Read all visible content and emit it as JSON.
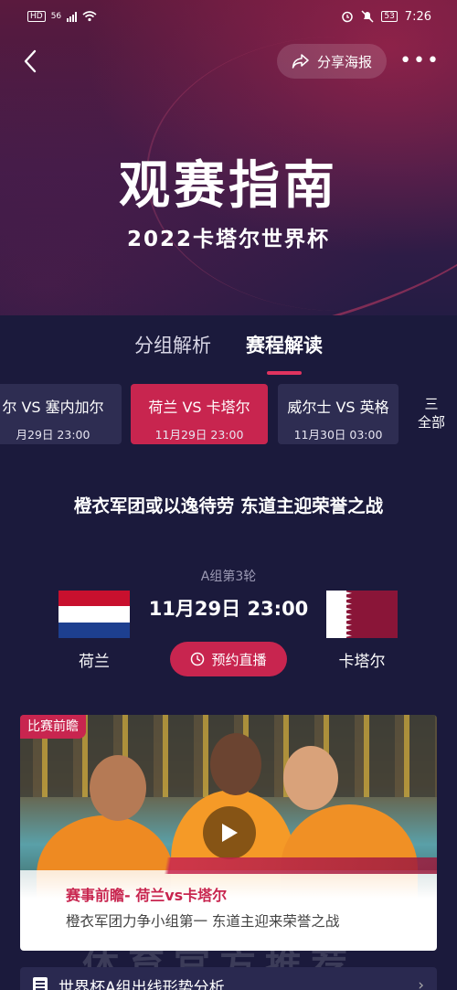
{
  "status_bar": {
    "network_label": "HD",
    "signal_label": "56",
    "battery": "53",
    "time": "7:26"
  },
  "topbar": {
    "share_label": "分享海报"
  },
  "hero": {
    "title": "观赛指南",
    "subtitle": "2022卡塔尔世界杯"
  },
  "tabs": [
    {
      "label": "分组解析",
      "active": false
    },
    {
      "label": "赛程解读",
      "active": true
    }
  ],
  "match_strip": {
    "items": [
      {
        "teams": "尔 VS 塞内加尔",
        "time": "月29日 23:00",
        "active": false
      },
      {
        "teams": "荷兰 VS 卡塔尔",
        "time": "11月29日 23:00",
        "active": true
      },
      {
        "teams": "威尔士 VS 英格",
        "time": "11月30日 03:00",
        "active": false
      }
    ],
    "all_label_1": "三",
    "all_label_2": "全部"
  },
  "match_detail": {
    "headline": "橙衣军团或以逸待劳 东道主迎荣誉之战",
    "round": "A组第3轮",
    "datetime": "11月29日 23:00",
    "home_team": "荷兰",
    "away_team": "卡塔尔",
    "reserve_label": "预约直播"
  },
  "video_card": {
    "tag": "比赛前瞻",
    "title": "赛事前瞻- 荷兰vs卡塔尔",
    "subtitle": "橙衣军团力争小组第一 东道主迎来荣誉之战"
  },
  "bottom_item": {
    "label": "世界杯A组出线形势分析",
    "watermark": "体育官方推荐"
  },
  "colors": {
    "accent": "#c8254f",
    "background": "#1b1a3c",
    "card": "#2e2d52"
  }
}
